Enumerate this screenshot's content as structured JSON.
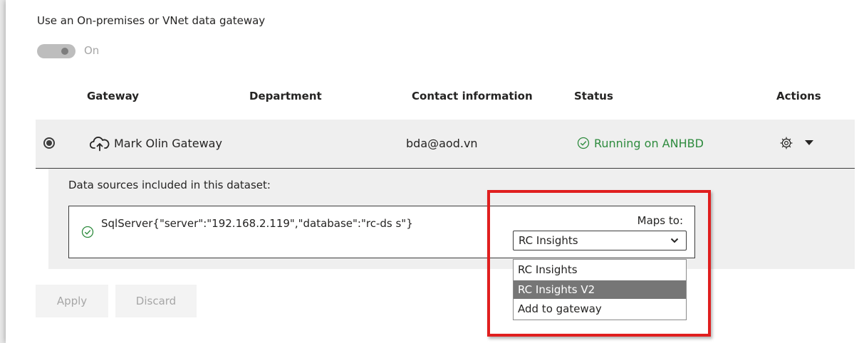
{
  "gateway_toggle": {
    "label": "Use an On-premises or VNet data gateway",
    "state_text": "On"
  },
  "table": {
    "headers": {
      "gateway": "Gateway",
      "department": "Department",
      "contact": "Contact information",
      "status": "Status",
      "actions": "Actions"
    },
    "row": {
      "gateway_name": "Mark Olin Gateway",
      "department": "",
      "contact": "bda@aod.vn",
      "status": "Running on ANHBD",
      "icon": "cloud-upload-icon"
    }
  },
  "data_sources": {
    "label": "Data sources included in this dataset:",
    "source_text": "SqlServer{\"server\":\"192.168.2.119\",\"database\":\"rc-ds s\"}",
    "maps_to_label": "Maps to:",
    "selected_value": "RC Insights",
    "options": [
      "RC Insights",
      "RC Insights V2",
      "Add to gateway"
    ],
    "highlighted_option": "RC Insights V2"
  },
  "buttons": {
    "apply": "Apply",
    "discard": "Discard"
  },
  "colors": {
    "status_green": "#2e8b3e",
    "highlight_red": "#e01f1f",
    "selected_option_bg": "#767676"
  }
}
